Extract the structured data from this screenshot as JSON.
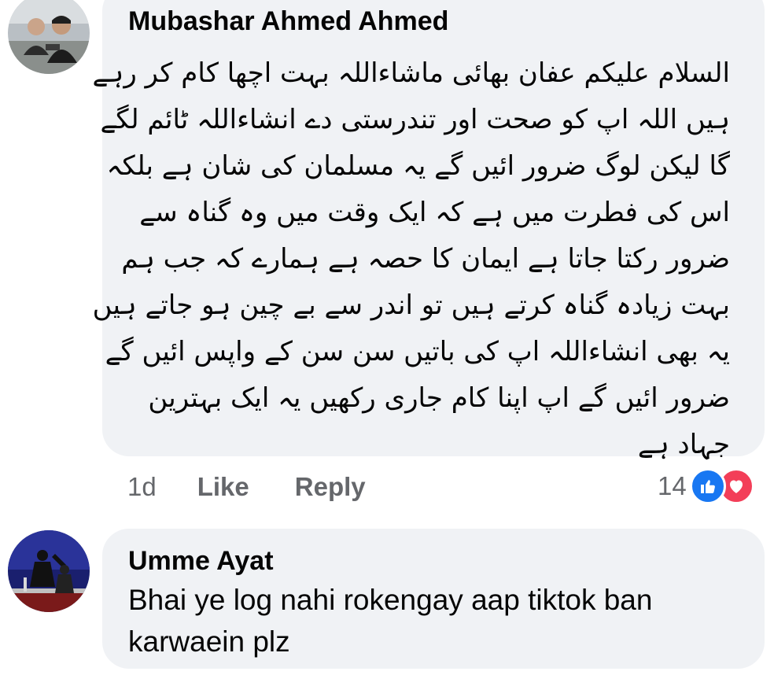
{
  "comments": [
    {
      "author": "Mubashar Ahmed Ahmed",
      "lines": [
        "السلام علیکم عفان بھائی ماشاءاللہ بہت اچھا کام کر رہے",
        "ہیں اللہ اپ کو صحت اور تندرستی دے انشاءاللہ ٹائم لگے",
        "گا لیکن لوگ ضرور ائیں گے یہ مسلمان کی شان ہے بلکہ",
        "اس کی فطرت میں ہے کہ ایک وقت میں وہ گناہ سے",
        "ضرور رکتا جاتا ہے ایمان کا حصہ ہے ہمارے کہ جب ہم",
        "بہت زیادہ گناہ کرتے ہیں تو اندر سے بے چین ہو جاتے ہیں",
        "یہ بھی انشاءاللہ اپ کی باتیں سن سن کے واپس ائیں گے",
        "ضرور ائیں گے اپ اپنا کام جاری رکھیں یہ ایک بہترین",
        "جہاد ہے"
      ],
      "time": "1d",
      "like_label": "Like",
      "reply_label": "Reply",
      "reaction_count": "14",
      "reactions": [
        "like-icon",
        "love-icon"
      ]
    },
    {
      "author": "Umme Ayat",
      "lines": [
        "Bhai ye log nahi rokengay aap tiktok ban",
        "karwaein plz"
      ]
    }
  ],
  "colors": {
    "bubble_bg": "#f0f2f5",
    "text": "#050505",
    "secondary_text": "#65676b",
    "like_blue": "#1877f2",
    "love_red": "#f33e58"
  }
}
